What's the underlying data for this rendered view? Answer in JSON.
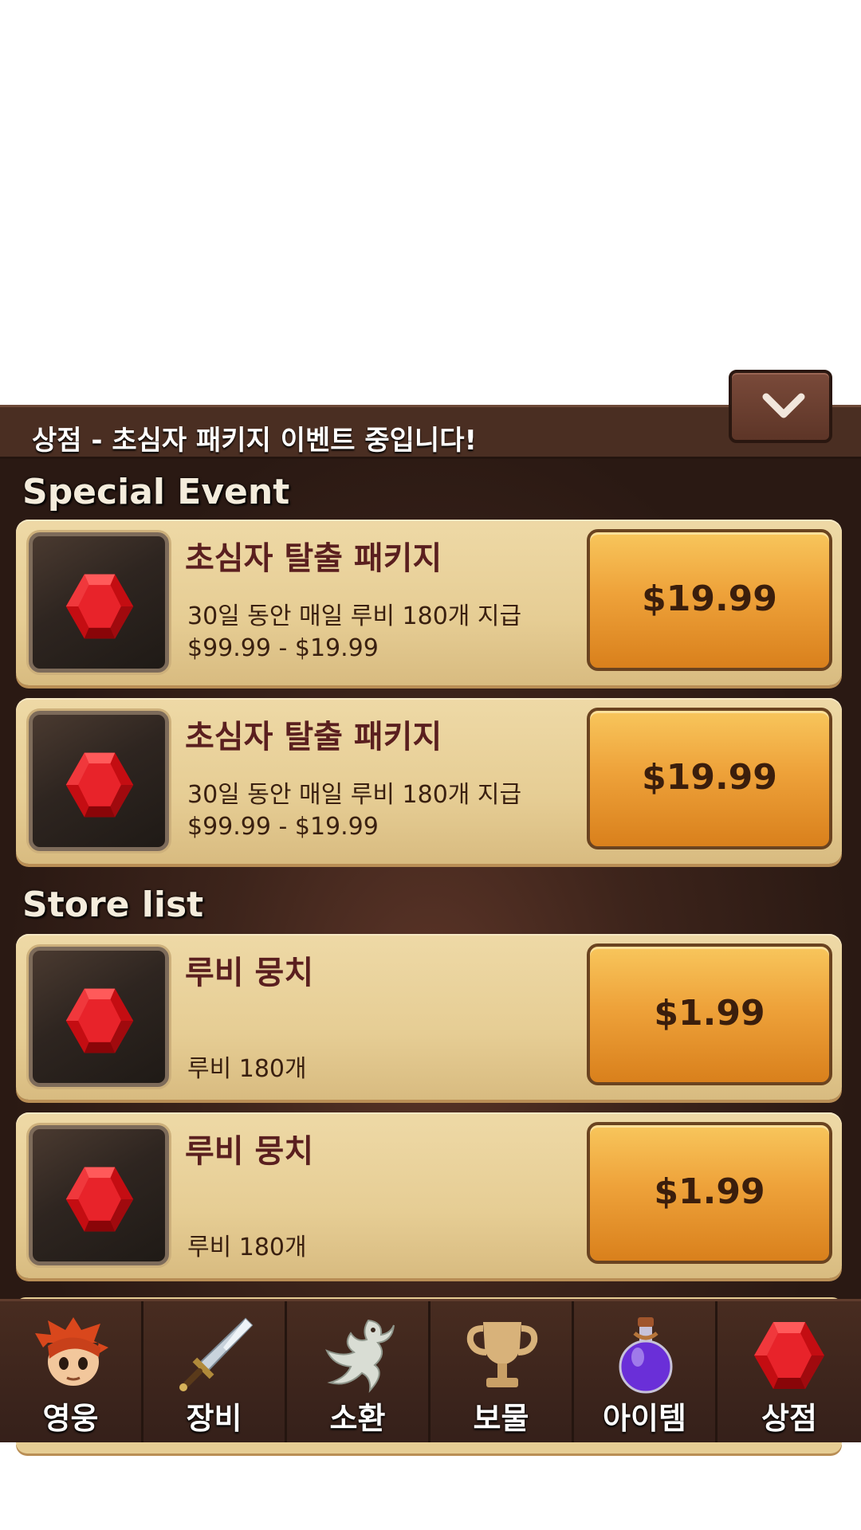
{
  "header": {
    "title": "상점 - 초심자 패키지 이벤트 중입니다!"
  },
  "sections": {
    "special": "Special Event",
    "store": "Store list"
  },
  "special_items": [
    {
      "name": "초심자 탈출 패키지",
      "desc1": "30일 동안 매일 루비 180개 지급",
      "desc2": "$99.99 - $19.99",
      "price": "$19.99"
    },
    {
      "name": "초심자 탈출 패키지",
      "desc1": "30일 동안 매일 루비 180개 지급",
      "desc2": "$99.99 - $19.99",
      "price": "$19.99"
    }
  ],
  "store_items": [
    {
      "name": "루비 뭉치",
      "desc": "루비 180개",
      "price": "$1.99"
    },
    {
      "name": "루비 뭉치",
      "desc": "루비 180개",
      "price": "$1.99"
    }
  ],
  "tabs": [
    {
      "label": "영웅",
      "icon": "hero-icon"
    },
    {
      "label": "장비",
      "icon": "sword-icon"
    },
    {
      "label": "소환",
      "icon": "dragon-icon"
    },
    {
      "label": "보물",
      "icon": "trophy-icon"
    },
    {
      "label": "아이템",
      "icon": "potion-icon"
    },
    {
      "label": "상점",
      "icon": "ruby-icon"
    }
  ],
  "colors": {
    "accent": "#eea23a",
    "panel": "#3d241b",
    "card": "#e6cd94"
  }
}
